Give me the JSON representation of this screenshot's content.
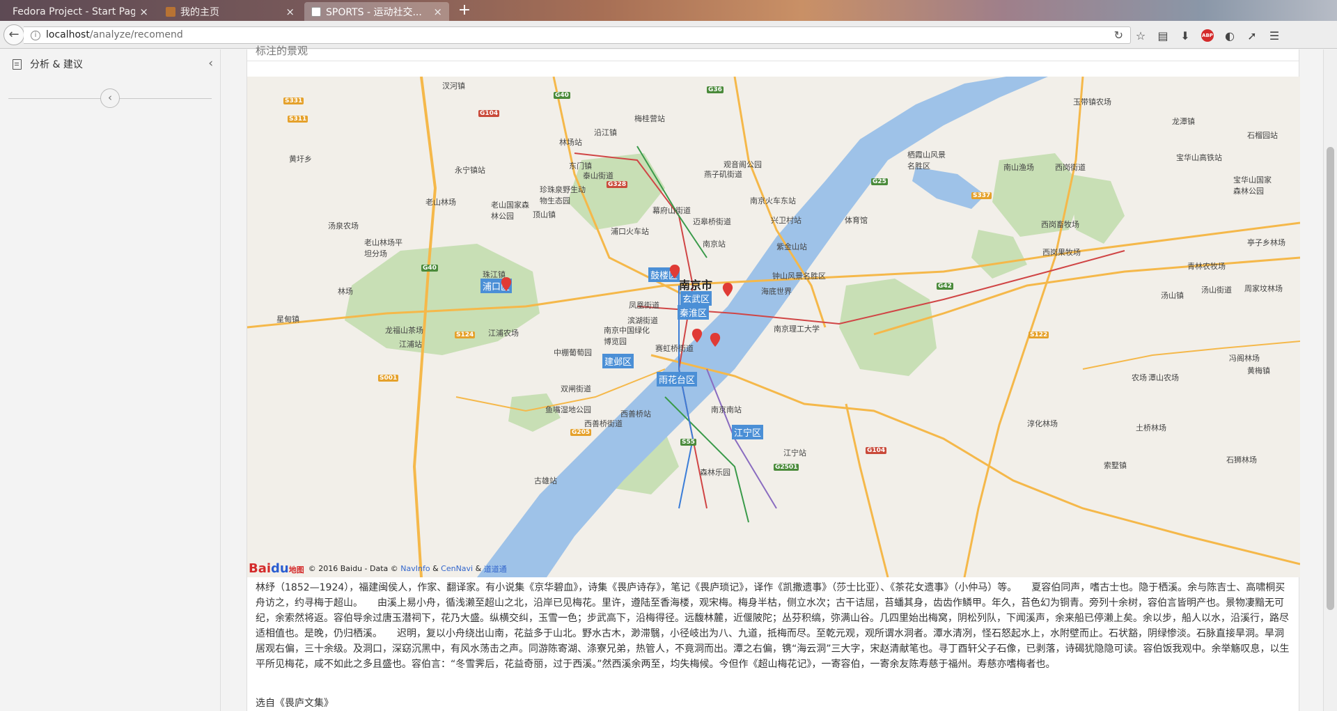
{
  "browser": {
    "tabs": [
      {
        "title": "Fedora Project - Start Page",
        "active": false
      },
      {
        "title": "我的主页",
        "active": false
      },
      {
        "title": "SPORTS - 运动社交...",
        "active": true
      }
    ],
    "url_host": "localhost",
    "url_path": "/analyze/recomend"
  },
  "sidebar": {
    "item_label": "分析 & 建议"
  },
  "panel": {
    "title": "标注的景观"
  },
  "map": {
    "labels": [
      {
        "text": "汊河镇"
      },
      {
        "text": "沿江镇"
      },
      {
        "text": "梅桂营站"
      },
      {
        "text": "林场站"
      },
      {
        "text": "东门镇"
      },
      {
        "text": "泰山街道"
      },
      {
        "text": "永宁镇站"
      },
      {
        "text": "珍珠泉野生动物生态园"
      },
      {
        "text": "老山林场"
      },
      {
        "text": "老山国家森林公园"
      },
      {
        "text": "顶山镇"
      },
      {
        "text": "黄圩乡"
      },
      {
        "text": "汤泉农场"
      },
      {
        "text": "老山林场平坦分场"
      },
      {
        "text": "珠江镇"
      },
      {
        "text": "浦口火车站"
      },
      {
        "text": "幕府山街道"
      },
      {
        "text": "迈皋桥街道"
      },
      {
        "text": "燕子矶街道"
      },
      {
        "text": "观音阁公园"
      },
      {
        "text": "南京火车东站"
      },
      {
        "text": "南京站"
      },
      {
        "text": "紫金山站"
      },
      {
        "text": "兴卫村站"
      },
      {
        "text": "体育馆"
      },
      {
        "text": "南京市"
      },
      {
        "text": "钟山风景名胜区"
      },
      {
        "text": "海底世界"
      },
      {
        "text": "凤凰街道"
      },
      {
        "text": "滨湖街道"
      },
      {
        "text": "南京中国绿化博览园"
      },
      {
        "text": "赛虹桥街道"
      },
      {
        "text": "江浦农场"
      },
      {
        "text": "中棚葡萄园"
      },
      {
        "text": "双闸街道"
      },
      {
        "text": "鱼嘴湿地公园"
      },
      {
        "text": "西善桥街道"
      },
      {
        "text": "西善桥站"
      },
      {
        "text": "南京南站"
      },
      {
        "text": "南京理工大学"
      },
      {
        "text": "栖霞山风景名胜区"
      },
      {
        "text": "玉带镇农场"
      },
      {
        "text": "龙潭镇"
      },
      {
        "text": "南山渔场"
      },
      {
        "text": "西岗街道"
      },
      {
        "text": "宝华山高铁站"
      },
      {
        "text": "宝华山国家森林公园"
      },
      {
        "text": "西岗畜牧场"
      },
      {
        "text": "西岗果牧场"
      },
      {
        "text": "亭子乡林场"
      },
      {
        "text": "青林农牧场"
      },
      {
        "text": "汤山街道"
      },
      {
        "text": "周家坟林场"
      },
      {
        "text": "汤山镇"
      },
      {
        "text": "淳化林场"
      },
      {
        "text": "土桥林场"
      },
      {
        "text": "冯阁林场"
      },
      {
        "text": "黄梅镇"
      },
      {
        "text": "农场"
      },
      {
        "text": "潭山农场"
      },
      {
        "text": "索墅镇"
      },
      {
        "text": "石狮林场"
      },
      {
        "text": "江宁站"
      },
      {
        "text": "森林乐园"
      },
      {
        "text": "古雄站"
      },
      {
        "text": "星甸镇"
      },
      {
        "text": "龙福山茶场"
      },
      {
        "text": "江浦站"
      },
      {
        "text": "林场"
      },
      {
        "text": "石榴园站"
      }
    ],
    "districts": [
      "浦口区",
      "鼓楼区",
      "玄武区",
      "秦淮区",
      "建邺区",
      "雨花台区",
      "江宁区"
    ],
    "shields": [
      "G40",
      "G104",
      "G36",
      "S331",
      "S311",
      "G328",
      "G25",
      "S337",
      "G42",
      "G40",
      "S124",
      "S001",
      "G205",
      "S55",
      "G2501",
      "G104",
      "S122"
    ],
    "credit_text": "© 2016 Baidu - Data ©",
    "credit_links": [
      "NavInfo",
      "CenNavi",
      "道道通"
    ],
    "credit_amp": "&",
    "logo_bai": "Bai",
    "logo_du": "du",
    "logo_suffix": "地图"
  },
  "article": {
    "text": "林纾（1852—1924），福建闽侯人，作家、翻译家。有小说集《京华碧血》，诗集《畏庐诗存》，笔记《畏庐琐记》，译作《凯撒遗事》（莎士比亚）、《茶花女遗事》（小仲马）等。　　夏容伯同声，嗜古士也。隐于栖溪。余与陈吉士、高啸桐买舟访之，约寻梅于超山。　　由溪上易小舟，循浅濑至超山之北，沿岸已见梅花。里许，遵陆至香海楼，观宋梅。梅身半枯，侧立水次；古干诘屈，苔蟠其身，齿齿作鳞甲。年久，苔色幻为铜青。旁列十余树，容伯言皆明产也。景物凄黯无可纪，余索然将返。容伯导余过唐玉潜祠下，花乃大盛。纵横交纠，玉雪一色；步武高下，沿梅得径。远馥林麓，近偃陂陀；丛芬积缟，弥满山谷。几四里始出梅窝，阴松列队，下闻溪声，余来船已停濑上矣。余以步，船人以水，沿溪行，路尽适相值也。是晚，仍归栖溪。　　迟明，复以小舟绕出山南，花益多于山北。野水古木，渺滞翳，小径岐出为八、九道，抵梅而尽。至乾元观，观所谓水洞者。潭水清冽，怪石怒起水上，水附壁而止。石状豁，阴绿惨淡。石脉直接旱洞。旱洞居观右偏，三十余级。及洞口，深窈沉黑中，有风水荡击之声。同游陈寄湖、涤寮兄弟，热管人，不竟洞而出。潭之右偏，镌“海云洞”三大字，宋赵清献笔也。寻丁酉轩父子石像，已剥落，诗碣犹隐隐可读。容伯饭我观中。余举觞叹息，以生平所见梅花，咸不如此之多且盛也。容伯言：“冬雪霁后，花益奇丽，过于西溪。”然西溪余两至，均失梅候。今但作《超山梅花记》，一寄容伯，一寄余友陈寿慈于福州。寿慈亦嗜梅者也。",
    "source": "选自《畏庐文集》"
  },
  "colors": {
    "water": "#9ec2e8",
    "park": "#c8dfb5",
    "road_major": "#f5b84a",
    "pin": "#e03b35",
    "district_tag": "#4b8fd6"
  }
}
